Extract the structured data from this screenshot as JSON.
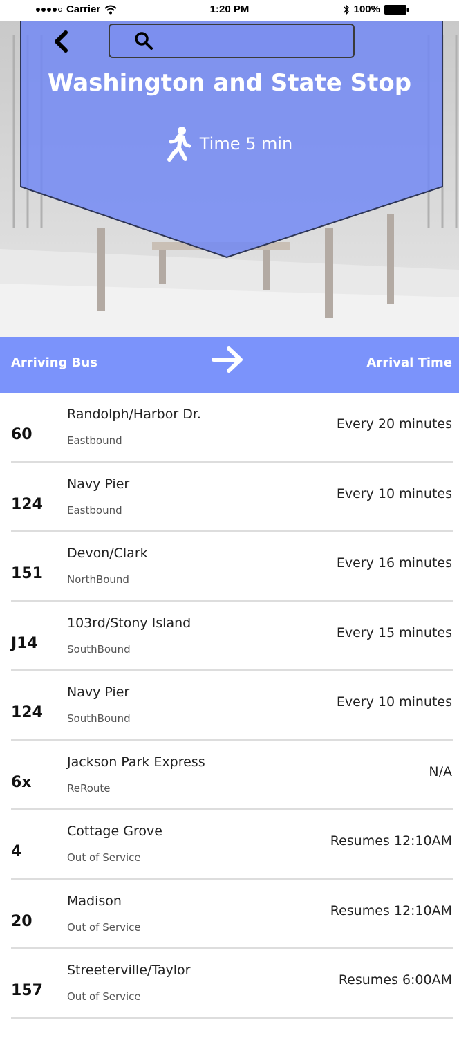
{
  "status_bar": {
    "carrier": "Carrier",
    "time": "1:20 PM",
    "battery": "100%"
  },
  "stop": {
    "title": "Washington and State Stop",
    "walk_time": "Time 5 min"
  },
  "search": {
    "placeholder": ""
  },
  "list_header": {
    "left_label": "Arriving Bus",
    "right_label": "Arrival Time"
  },
  "routes": [
    {
      "number": "60",
      "name": "Randolph/Harbor Dr.",
      "direction": "Eastbound",
      "time": "Every 20 minutes"
    },
    {
      "number": "124",
      "name": "Navy Pier",
      "direction": "Eastbound",
      "time": "Every 10 minutes"
    },
    {
      "number": "151",
      "name": "Devon/Clark",
      "direction": "NorthBound",
      "time": "Every 16 minutes"
    },
    {
      "number": "J14",
      "name": "103rd/Stony Island",
      "direction": "SouthBound",
      "time": "Every 15 minutes"
    },
    {
      "number": "124",
      "name": "Navy Pier",
      "direction": "SouthBound",
      "time": "Every 10 minutes"
    },
    {
      "number": "6x",
      "name": "Jackson Park Express",
      "direction": "ReRoute",
      "time": "N/A"
    },
    {
      "number": "4",
      "name": "Cottage Grove",
      "direction": "Out of Service",
      "time": "Resumes 12:10AM"
    },
    {
      "number": "20",
      "name": "Madison",
      "direction": "Out of Service",
      "time": "Resumes 12:10AM"
    },
    {
      "number": "157",
      "name": "Streeterville/Taylor",
      "direction": "Out of Service",
      "time": "Resumes 6:00AM"
    }
  ],
  "colors": {
    "accent": "#7b93fb",
    "banner": "#6f86f5"
  },
  "icons": {
    "back": "chevron-left-icon",
    "search": "search-icon",
    "walk": "walking-person-icon",
    "arrow": "arrow-right-icon"
  }
}
